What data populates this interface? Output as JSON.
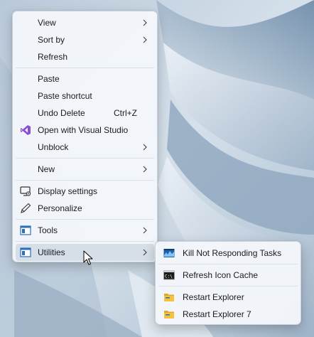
{
  "context_menu": {
    "items": [
      {
        "label": "View"
      },
      {
        "label": "Sort by"
      },
      {
        "label": "Refresh"
      },
      {
        "label": "Paste"
      },
      {
        "label": "Paste shortcut"
      },
      {
        "label": "Undo Delete",
        "shortcut": "Ctrl+Z"
      },
      {
        "label": "Open with Visual Studio",
        "icon": "visual-studio-icon"
      },
      {
        "label": "Unblock"
      },
      {
        "label": "New"
      },
      {
        "label": "Display settings",
        "icon": "display-settings-icon"
      },
      {
        "label": "Personalize",
        "icon": "pen-icon"
      },
      {
        "label": "Tools",
        "icon": "window-icon"
      },
      {
        "label": "Utilities",
        "icon": "window-icon"
      }
    ]
  },
  "submenu": {
    "items": [
      {
        "label": "Kill Not Responding Tasks",
        "icon": "task-kill-icon"
      },
      {
        "label": "Refresh Icon Cache",
        "icon": "terminal-icon"
      },
      {
        "label": "Restart Explorer",
        "icon": "folder-icon"
      },
      {
        "label": "Restart Explorer 7",
        "icon": "folder-icon"
      }
    ]
  },
  "colors": {
    "menu_background": "#f3f6fa",
    "highlight": "#d6dee7",
    "visual_studio_purple": "#8a4fd3",
    "folder_yellow": "#f4c23c"
  }
}
